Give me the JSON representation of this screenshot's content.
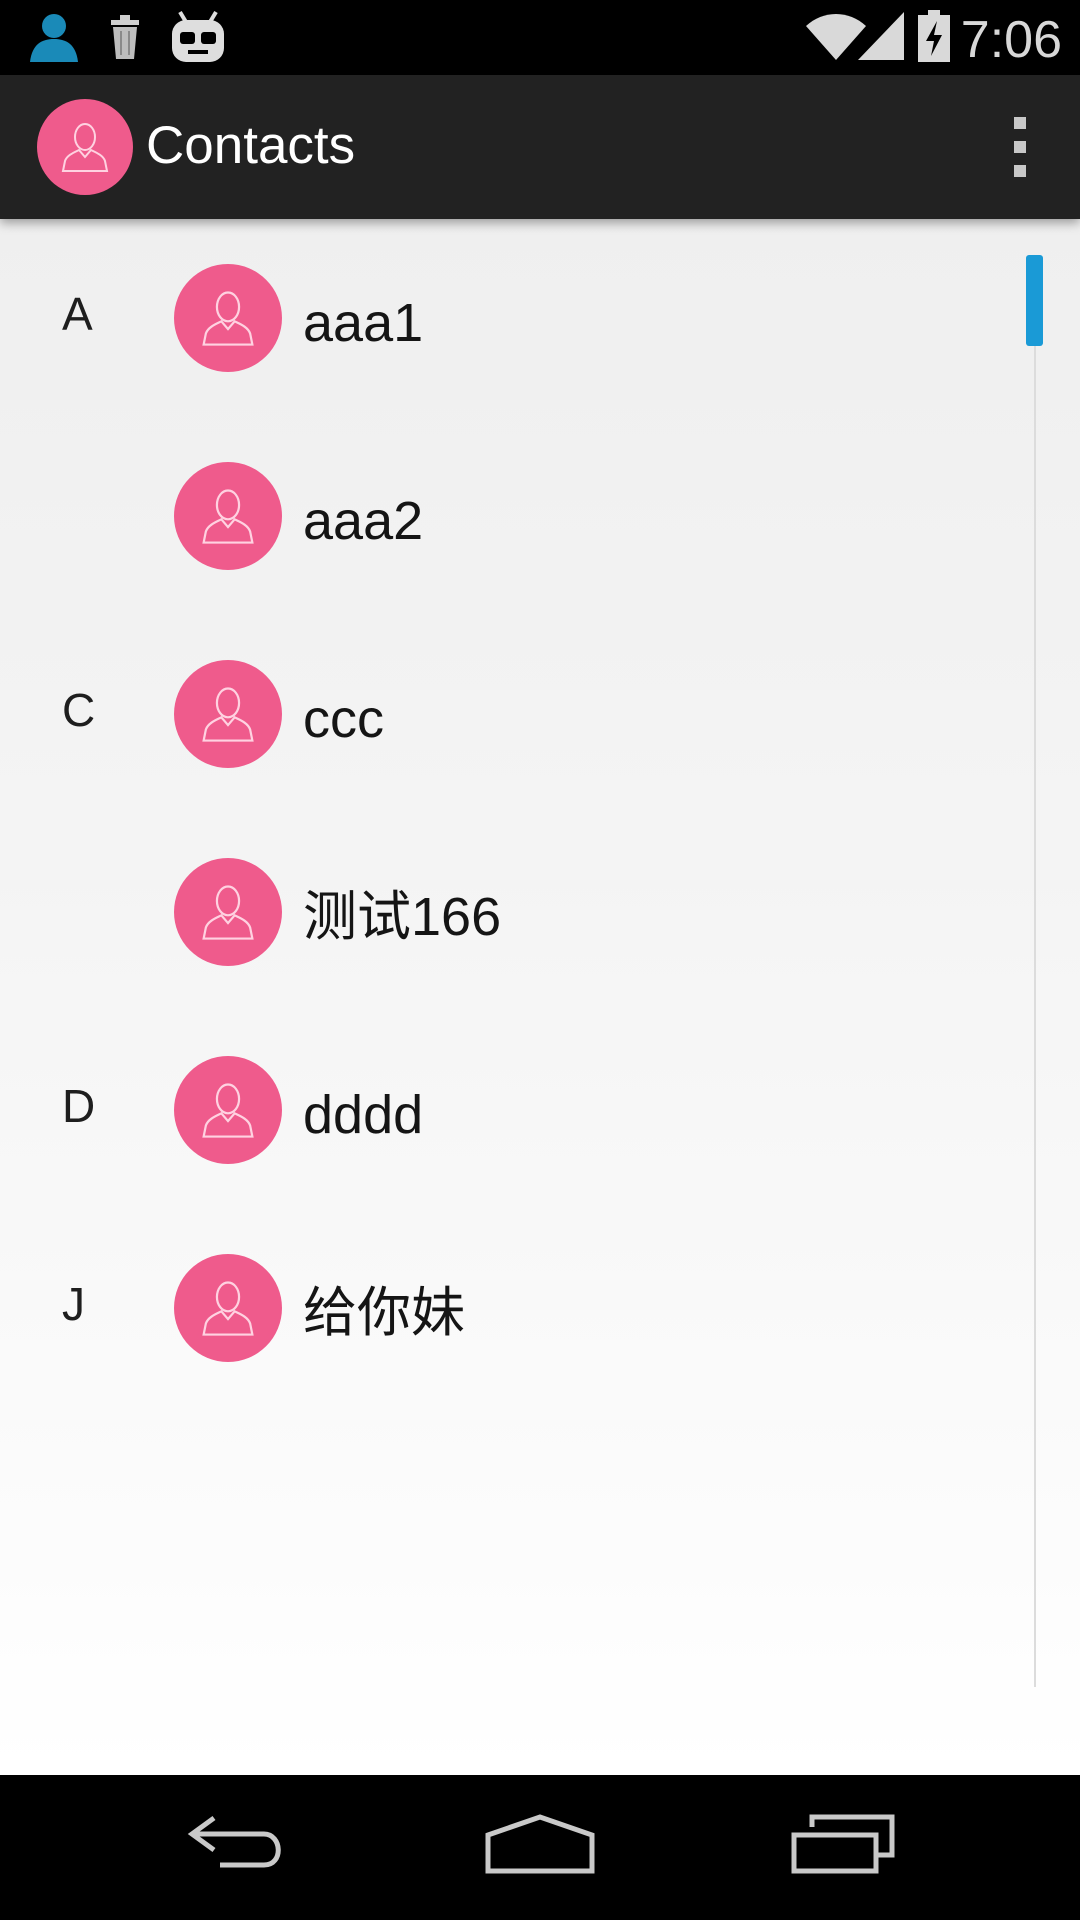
{
  "status_bar": {
    "time": "7:06",
    "icons": [
      "person-notification-icon",
      "trash-notification-icon",
      "cyanogenmod-icon",
      "wifi-icon",
      "cell-signal-icon",
      "battery-charging-icon"
    ],
    "accent_color": "#1a8ab8"
  },
  "action_bar": {
    "title": "Contacts",
    "app_icon": "contact-avatar-icon",
    "menu_icon": "overflow-menu-icon",
    "background": "#222222"
  },
  "contacts": [
    {
      "section": "A",
      "name": "aaa1"
    },
    {
      "section": "",
      "name": "aaa2"
    },
    {
      "section": "C",
      "name": "ccc"
    },
    {
      "section": "",
      "name": "测试166"
    },
    {
      "section": "D",
      "name": "dddd"
    },
    {
      "section": "J",
      "name": "给你妹"
    }
  ],
  "colors": {
    "avatar": "#ef5b8c",
    "scroll_thumb": "#1a9ad6"
  },
  "nav_bar": {
    "buttons": [
      "back-icon",
      "home-icon",
      "recents-icon"
    ]
  }
}
